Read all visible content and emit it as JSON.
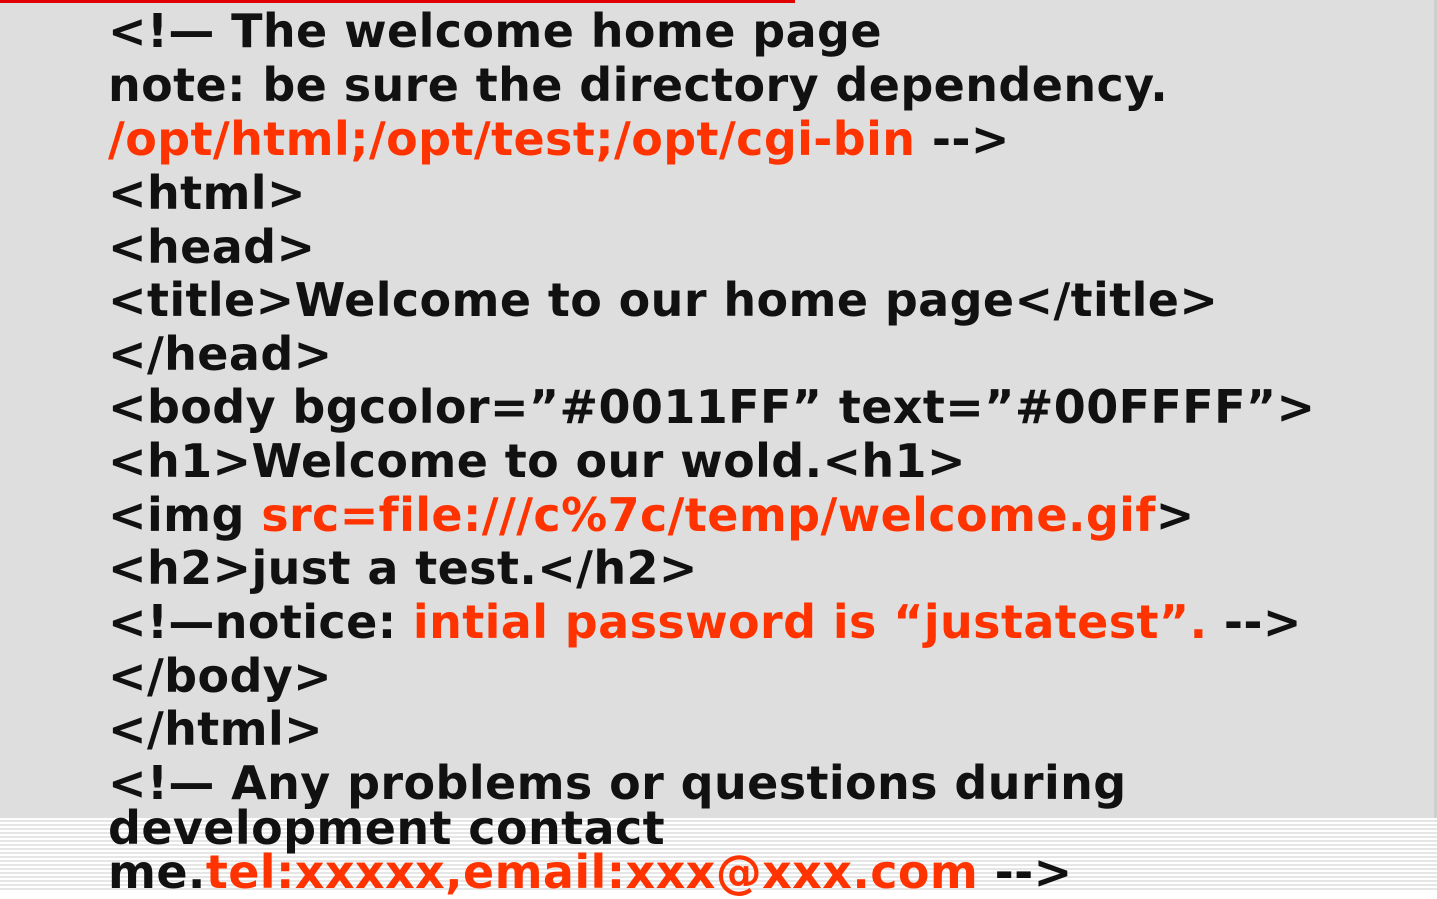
{
  "colors": {
    "text": "#111111",
    "highlight": "#ff3300",
    "panel": "#dedede",
    "accent_bar": "#e00000"
  },
  "lines": [
    {
      "segments": [
        {
          "text": "<!— The welcome home page",
          "hl": false
        }
      ]
    },
    {
      "segments": [
        {
          "text": "note: be sure the directory dependency.",
          "hl": false
        }
      ]
    },
    {
      "segments": [
        {
          "text": "/opt/html;/opt/test;/opt/cgi-bin",
          "hl": true
        },
        {
          "text": " -->",
          "hl": false
        }
      ]
    },
    {
      "segments": [
        {
          "text": "<html>",
          "hl": false
        }
      ]
    },
    {
      "segments": [
        {
          "text": "<head>",
          "hl": false
        }
      ]
    },
    {
      "segments": [
        {
          "text": "<title>Welcome to our home page</title>",
          "hl": false
        }
      ]
    },
    {
      "segments": [
        {
          "text": "</head>",
          "hl": false
        }
      ]
    },
    {
      "segments": [
        {
          "text": "<body bgcolor=”#0011FF” text=”#00FFFF”>",
          "hl": false
        }
      ]
    },
    {
      "segments": [
        {
          "text": "<h1>Welcome to our wold.<h1>",
          "hl": false
        }
      ]
    },
    {
      "segments": [
        {
          "text": "<img ",
          "hl": false
        },
        {
          "text": "src=file:///c%7c/temp/welcome.gif",
          "hl": true
        },
        {
          "text": ">",
          "hl": false
        }
      ]
    },
    {
      "segments": [
        {
          "text": "<h2>just a test.</h2>",
          "hl": false
        }
      ]
    },
    {
      "segments": [
        {
          "text": "<!—notice: ",
          "hl": false
        },
        {
          "text": "intial password is “justatest”.",
          "hl": true
        },
        {
          "text": " -->",
          "hl": false
        }
      ]
    },
    {
      "segments": [
        {
          "text": "</body>",
          "hl": false
        }
      ]
    },
    {
      "segments": [
        {
          "text": "</html>",
          "hl": false
        }
      ]
    },
    {
      "segments": [
        {
          "text": "<!— Any problems or questions during",
          "hl": false
        }
      ]
    },
    {
      "segments": [
        {
          "text": "development contact",
          "hl": false
        }
      ]
    },
    {
      "segments": [
        {
          "text": "me.",
          "hl": false
        },
        {
          "text": "tel:xxxxx,email:xxx@xxx.com",
          "hl": true
        },
        {
          "text": " -->",
          "hl": false
        }
      ]
    }
  ]
}
